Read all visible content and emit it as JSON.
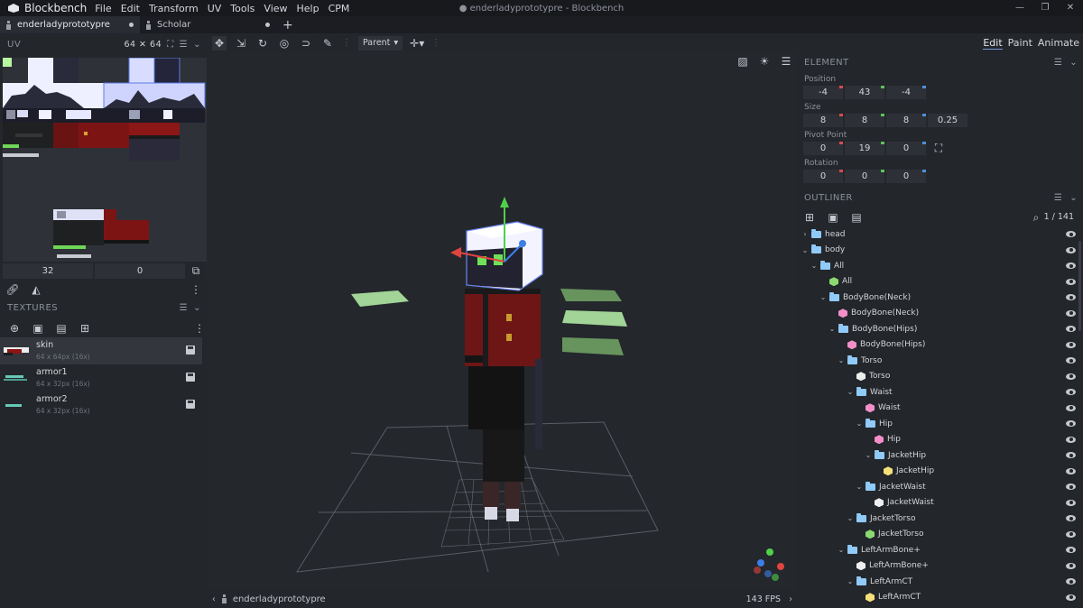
{
  "app": {
    "name": "Blockbench"
  },
  "menu": [
    "File",
    "Edit",
    "Transform",
    "UV",
    "Tools",
    "View",
    "Help",
    "CPM"
  ],
  "window_title": "● enderladyprototypre - Blockbench",
  "tabs": [
    {
      "label": "enderladyprototypre",
      "active": true
    },
    {
      "label": "Scholar",
      "active": false
    }
  ],
  "uv_panel": {
    "title": "UV",
    "size": "64 ✕ 64",
    "inputs": [
      "32",
      "0"
    ]
  },
  "textures_panel": {
    "title": "TEXTURES",
    "items": [
      {
        "name": "skin",
        "meta": "64 x 64px (16x)",
        "selected": true
      },
      {
        "name": "armor1",
        "meta": "64 x 32px (16x)",
        "selected": false
      },
      {
        "name": "armor2",
        "meta": "64 x 32px (16x)",
        "selected": false
      }
    ]
  },
  "toolbar": {
    "pivot_mode": "Parent"
  },
  "modes": [
    "Edit",
    "Paint",
    "Animate"
  ],
  "element_panel": {
    "title": "ELEMENT",
    "position_label": "Position",
    "position": [
      "-4",
      "43",
      "-4"
    ],
    "size_label": "Size",
    "size": [
      "8",
      "8",
      "8",
      "0.25"
    ],
    "pivot_label": "Pivot Point",
    "pivot": [
      "0",
      "19",
      "0"
    ],
    "rotation_label": "Rotation",
    "rotation": [
      "0",
      "0",
      "0"
    ]
  },
  "outliner": {
    "title": "OUTLINER",
    "count": "1 / 141",
    "nodes": [
      {
        "label": "head",
        "type": "group",
        "depth": 0,
        "expanded": false
      },
      {
        "label": "body",
        "type": "group",
        "depth": 0,
        "expanded": true
      },
      {
        "label": "All",
        "type": "group",
        "depth": 1,
        "expanded": true
      },
      {
        "label": "All",
        "type": "cube",
        "depth": 2,
        "color": "#8bd96f"
      },
      {
        "label": "BodyBone(Neck)",
        "type": "group",
        "depth": 2,
        "expanded": true
      },
      {
        "label": "BodyBone(Neck)",
        "type": "cube",
        "depth": 3,
        "color": "#f28fc8"
      },
      {
        "label": "BodyBone(Hips)",
        "type": "group",
        "depth": 3,
        "expanded": true
      },
      {
        "label": "BodyBone(Hips)",
        "type": "cube",
        "depth": 4,
        "color": "#f28fc8"
      },
      {
        "label": "Torso",
        "type": "group",
        "depth": 4,
        "expanded": true
      },
      {
        "label": "Torso",
        "type": "cube",
        "depth": 5,
        "color": "#eeeeee"
      },
      {
        "label": "Waist",
        "type": "group",
        "depth": 5,
        "expanded": true
      },
      {
        "label": "Waist",
        "type": "cube",
        "depth": 6,
        "color": "#f28fc8"
      },
      {
        "label": "Hip",
        "type": "group",
        "depth": 6,
        "expanded": true
      },
      {
        "label": "Hip",
        "type": "cube",
        "depth": 7,
        "color": "#f28fc8"
      },
      {
        "label": "JacketHip",
        "type": "group",
        "depth": 7,
        "expanded": true
      },
      {
        "label": "JacketHip",
        "type": "cube",
        "depth": 8,
        "color": "#f5e07a"
      },
      {
        "label": "JacketWaist",
        "type": "group",
        "depth": 6,
        "expanded": true
      },
      {
        "label": "JacketWaist",
        "type": "cube",
        "depth": 7,
        "color": "#eeeeee"
      },
      {
        "label": "JacketTorso",
        "type": "group",
        "depth": 5,
        "expanded": true
      },
      {
        "label": "JacketTorso",
        "type": "cube",
        "depth": 6,
        "color": "#8bd96f"
      },
      {
        "label": "LeftArmBone+",
        "type": "group",
        "depth": 4,
        "expanded": true
      },
      {
        "label": "LeftArmBone+",
        "type": "cube",
        "depth": 5,
        "color": "#eeeeee"
      },
      {
        "label": "LeftArmCT",
        "type": "group",
        "depth": 5,
        "expanded": true
      },
      {
        "label": "LeftArmCT",
        "type": "cube",
        "depth": 6,
        "color": "#f5e07a"
      }
    ]
  },
  "viewport": {
    "model_name": "enderladyprototypre",
    "fps": "143 FPS"
  }
}
